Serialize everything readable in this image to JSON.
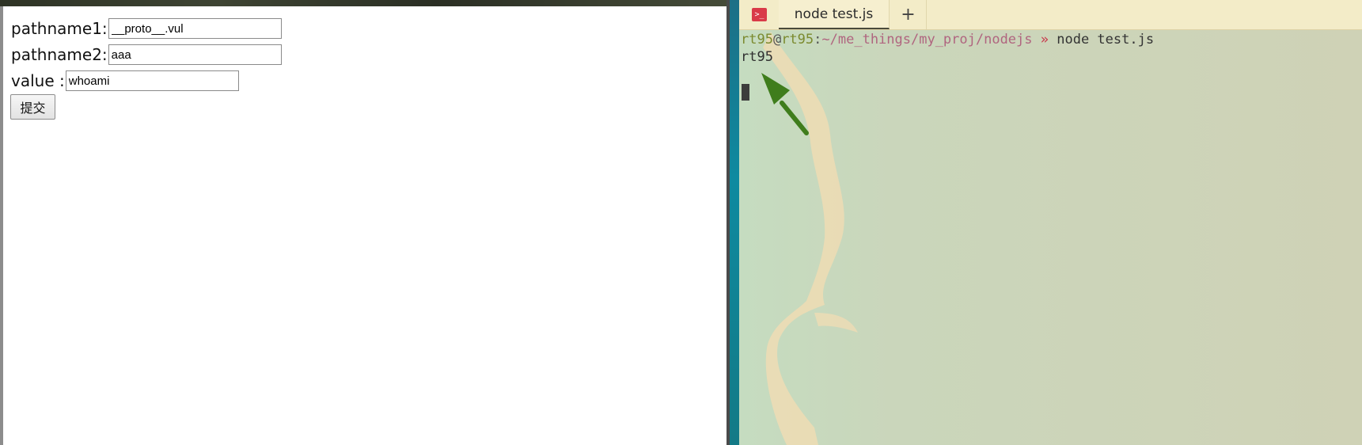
{
  "browser": {
    "form": {
      "pathname1_label": "pathname1:",
      "pathname1_value": "__proto__.vul",
      "pathname2_label": "pathname2:",
      "pathname2_value": "aaa",
      "value_label": "value :",
      "value_value": "whoami",
      "submit_label": "提交"
    }
  },
  "terminal": {
    "tab_title": "node test.js",
    "new_tab_symbol": "+",
    "terminal_icon_glyph": ">_",
    "prompt": {
      "user": "rt95",
      "at": "@",
      "host": "rt95",
      "separator": ":",
      "path": "~/me_things/my_proj/nodejs",
      "arrow": " » ",
      "command": "node test.js"
    },
    "output": "rt95",
    "colors": {
      "accent_icon": "#d93a48",
      "annotation_arrow": "#3f7d1c"
    }
  }
}
